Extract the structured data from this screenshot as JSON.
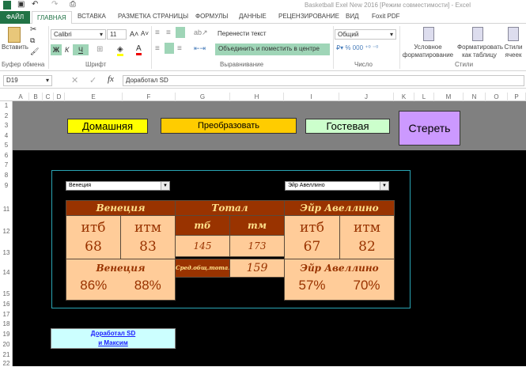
{
  "window": {
    "title": "Basketball Exel New 2016  [Режим совместимости] - Excel"
  },
  "tabs": [
    "ФАЙЛ",
    "ГЛАВНАЯ",
    "ВСТАВКА",
    "РАЗМЕТКА СТРАНИЦЫ",
    "ФОРМУЛЫ",
    "ДАННЫЕ",
    "РЕЦЕНЗИРОВАНИЕ",
    "ВИД",
    "Foxit PDF"
  ],
  "ribbon": {
    "paste": "Вставить",
    "clipboard": "Буфер обмена",
    "font_name": "Calibri",
    "font_size": "11",
    "bold": "Ж",
    "italic": "К",
    "underline": "Ч",
    "font_group": "Шрифт",
    "wrap": "Перенести текст",
    "merge": "Объединить и поместить в центре",
    "align_group": "Выравнивание",
    "number_format": "Общий",
    "number_group": "Число",
    "cond_format": "Условное форматирование",
    "format_table": "Форматировать как таблицу",
    "cell_styles": "Стили ячеек",
    "styles_group": "Стили"
  },
  "formula_bar": {
    "name_box": "D19",
    "fx": "fx",
    "value": "Доработал SD"
  },
  "columns": [
    "A",
    "B",
    "C",
    "D",
    "E",
    "F",
    "G",
    "H",
    "I",
    "J",
    "K",
    "L",
    "M",
    "N",
    "O",
    "P"
  ],
  "rows": [
    "1",
    "2",
    "3",
    "4",
    "5",
    "6",
    "7",
    "8",
    "9",
    "11",
    "12",
    "13",
    "14",
    "15",
    "16",
    "17",
    "18",
    "19",
    "20",
    "21",
    "22"
  ],
  "buttons": {
    "home": "Домашняя",
    "convert": "Преобразовать",
    "guest": "Гостевая",
    "clear": "Стереть"
  },
  "dropdowns": {
    "home": "Венеция",
    "guest": "Эйр Авеллино"
  },
  "table": {
    "home_team": "Венеция",
    "total": "Тотал",
    "guest_team": "Эйр Авеллино",
    "itb": "итб",
    "itm": "итм",
    "tb": "тб",
    "tm": "тм",
    "home_itb": "68",
    "home_itm": "83",
    "tb_val": "145",
    "tm_val": "173",
    "guest_itb": "67",
    "guest_itm": "82",
    "avg_label": "Сред.общ.тотал",
    "avg_val": "159",
    "home_team2": "Венеция",
    "guest_team2": "Эйр Авеллино",
    "home_pct1": "86%",
    "home_pct2": "88%",
    "guest_pct1": "57%",
    "guest_pct2": "70%"
  },
  "credit": {
    "line1": "Доработал SD",
    "line2": "и Максим"
  }
}
